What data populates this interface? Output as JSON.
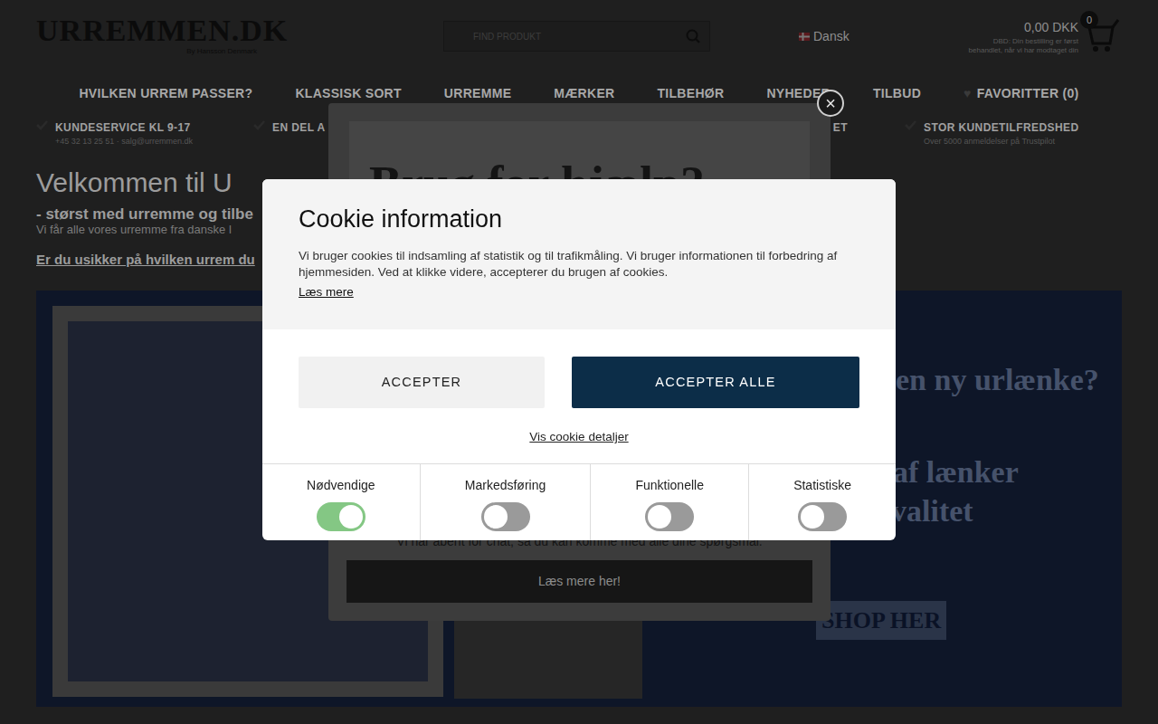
{
  "header": {
    "logo": "URREMMEN.DK",
    "logo_sub": "By Hansson Denmark",
    "search": {
      "placeholder": "FIND PRODUKT"
    },
    "language": "Dansk",
    "cart": {
      "amount": "0,00 DKK",
      "count": "0",
      "note": "DBD: Din bestilling er først behandlet, når vi har modtaget din"
    }
  },
  "nav": [
    {
      "label": "HVILKEN URREM PASSER?"
    },
    {
      "label": "KLASSISK SORT"
    },
    {
      "label": "URREMME"
    },
    {
      "label": "MÆRKER"
    },
    {
      "label": "TILBEHØR"
    },
    {
      "label": "NYHEDER"
    },
    {
      "label": "TILBUD"
    },
    {
      "label": "FAVORITTER (0)",
      "icon": "♥"
    }
  ],
  "usps": [
    {
      "title": "KUNDESERVICE KL 9-17",
      "sub": "+45 32 13 25 51 · salg@urremmen.dk"
    },
    {
      "title": "EN DEL A"
    },
    {
      "title": "ET"
    },
    {
      "title": "STOR KUNDETILFREDSHED",
      "sub": "Over 5000 anmeldelser på Trustpilot"
    }
  ],
  "welcome": {
    "title": "Velkommen til U",
    "subtitle": "- størst med urremme og tilbe",
    "text": "Vi får alle vores urremme fra danske l",
    "link": "Er du usikker på hvilken urrem du"
  },
  "banner": {
    "lines": [
      "en ny urlænke?",
      "valg af lænker",
      "ste kvalitet"
    ],
    "button": "SHOP HER"
  },
  "popup": {
    "close": "×",
    "title": "Brug for hjælp?",
    "text": "Vi har åbent for chat, så du kan komme med alle dine spørgsmål.",
    "button": "Læs mere her!"
  },
  "cookie": {
    "title": "Cookie information",
    "text": "Vi bruger cookies til indsamling af statistik og til trafikmåling. Vi bruger informationen til forbedring af hjemmesiden. Ved at klikke videre, accepterer du brugen af cookies.",
    "read_more": "Læs mere",
    "accept": "ACCEPTER",
    "accept_all": "ACCEPTER ALLE",
    "details": "Vis cookie detaljer",
    "categories": [
      {
        "label": "Nødvendige",
        "on": true
      },
      {
        "label": "Markedsføring",
        "on": false
      },
      {
        "label": "Funktionelle",
        "on": false
      },
      {
        "label": "Statistiske",
        "on": false
      }
    ]
  }
}
